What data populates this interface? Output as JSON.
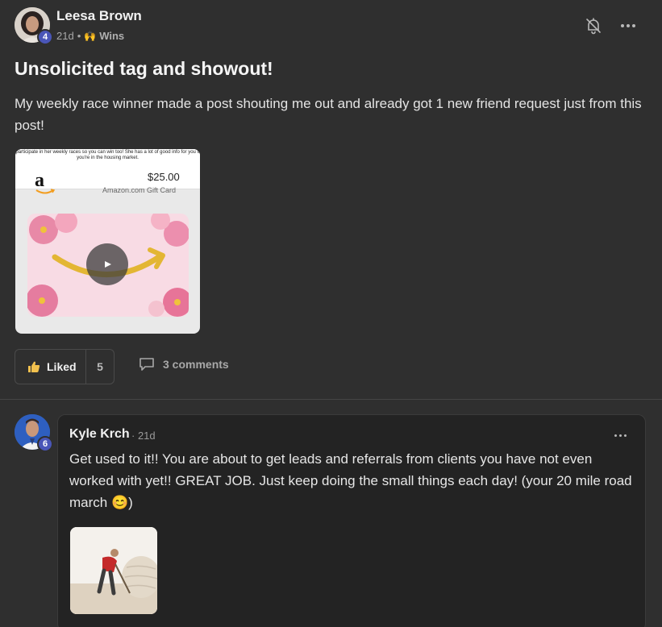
{
  "post": {
    "author": "Leesa Brown",
    "level": "4",
    "time": "21d",
    "separator": "•",
    "category_emoji": "🙌",
    "category": "Wins",
    "title": "Unsolicited tag and showout!",
    "body": "My weekly race winner made a post shouting me out and already got 1 new friend request just from this post!",
    "attachment": {
      "caption": "participate in her weekly races so you can win too! She has a lot of good info for you if you're in the housing market.",
      "price": "$25.00",
      "card_label": "Amazon.com Gift Card",
      "brand_letter": "a"
    },
    "like_label": "Liked",
    "like_count": "5",
    "comments_label": "3 comments"
  },
  "comment": {
    "author": "Kyle Krch",
    "level": "6",
    "time": "· 21d",
    "body": "Get used to it!! You are about to get leads and referrals from clients you have not even worked with yet!! GREAT JOB. Just keep doing the small things each day! (your 20 mile road march 😊)"
  },
  "colors": {
    "background": "#2f2f2f",
    "comment_background": "#232323",
    "badge": "#4a56b8",
    "like_icon": "#f2c14e"
  }
}
